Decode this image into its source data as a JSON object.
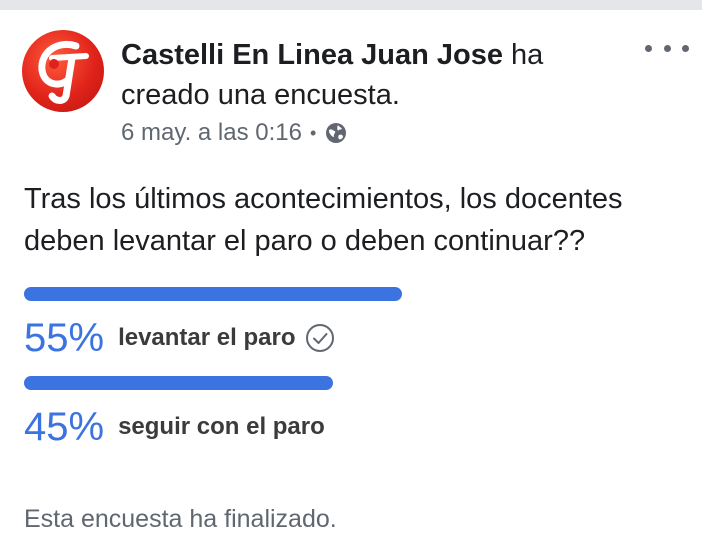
{
  "post": {
    "author": "Castelli En Linea Juan Jose",
    "action": "ha creado una encuesta.",
    "timestamp": "6 may. a las 0:16",
    "separator": "•",
    "privacy_icon": "globe-icon",
    "menu_icon": "more-options-icon"
  },
  "poll": {
    "question": "Tras los últimos acontecimientos, los docentes deben levantar el paro o deben continuar??",
    "options": [
      {
        "percent_label": "55%",
        "percent": 55,
        "label": "levantar el paro",
        "selected": true
      },
      {
        "percent_label": "45%",
        "percent": 45,
        "label": "seguir con el paro",
        "selected": false
      }
    ],
    "status": "Esta encuesta ha finalizado."
  },
  "colors": {
    "accent": "#3b73e0",
    "text": "#1c1e21",
    "secondary": "#606770"
  }
}
